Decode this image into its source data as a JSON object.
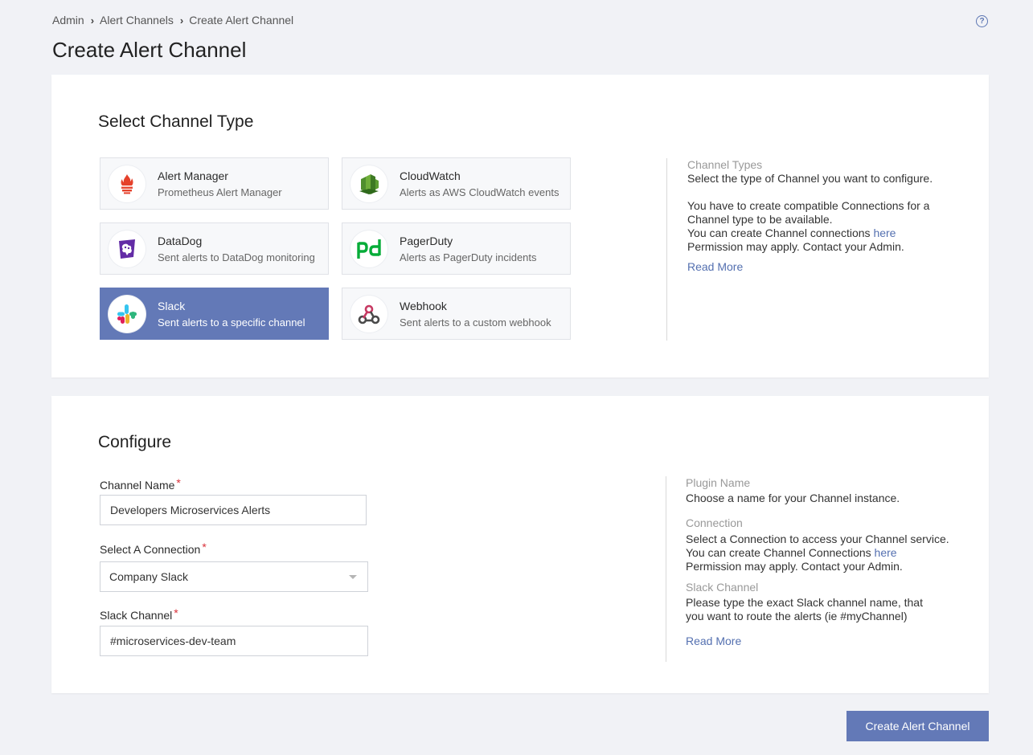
{
  "breadcrumb": [
    "Admin",
    "Alert Channels",
    "Create Alert Channel"
  ],
  "help_icon": "question-circle-icon",
  "page_title": "Create Alert Channel",
  "select_section": {
    "title": "Select Channel Type",
    "types": [
      {
        "name": "Alert Manager",
        "desc": "Prometheus Alert Manager",
        "icon": "prometheus-icon",
        "selected": false
      },
      {
        "name": "CloudWatch",
        "desc": "Alerts as AWS CloudWatch events",
        "icon": "cloudwatch-icon",
        "selected": false
      },
      {
        "name": "DataDog",
        "desc": "Sent alerts to DataDog monitoring",
        "icon": "datadog-icon",
        "selected": false
      },
      {
        "name": "PagerDuty",
        "desc": "Alerts as PagerDuty incidents",
        "icon": "pagerduty-icon",
        "selected": false
      },
      {
        "name": "Slack",
        "desc": "Sent alerts to a specific channel",
        "icon": "slack-icon",
        "selected": true
      },
      {
        "name": "Webhook",
        "desc": "Sent alerts to a custom webhook",
        "icon": "webhook-icon",
        "selected": false
      }
    ],
    "info": {
      "heading": "Channel Types",
      "line1": "Select the type of Channel you want to configure.",
      "line2": "You have to create compatible Connections for a Channel type to be available.",
      "line3_prefix": "You can create Channel connections ",
      "line3_link": "here",
      "line4": "Permission may apply. Contact your Admin.",
      "read_more": "Read More"
    }
  },
  "configure_section": {
    "title": "Configure",
    "channel_name": {
      "label": "Channel Name",
      "required_mark": "*",
      "value": "Developers Microservices Alerts"
    },
    "connection": {
      "label": "Select A Connection",
      "required_mark": "*",
      "value": "Company Slack"
    },
    "slack_channel": {
      "label": "Slack Channel",
      "required_mark": "*",
      "value": "#microservices-dev-team"
    },
    "info": {
      "plugin_heading": "Plugin Name",
      "plugin_text": "Choose a name for your Channel instance.",
      "connection_heading": "Connection",
      "connection_text": "Select a Connection to access your Channel service.",
      "connection_link_prefix": "You can create Channel Connections ",
      "connection_link": "here",
      "connection_permission": "Permission may apply. Contact your Admin.",
      "slack_heading": "Slack Channel",
      "slack_text": "Please type the exact Slack channel name, that you want to route the alerts (ie #myChannel)",
      "read_more": "Read More"
    }
  },
  "submit_label": "Create Alert Channel",
  "colors": {
    "accent": "#6379b7",
    "link": "#5470b0",
    "required": "#d9313a"
  }
}
